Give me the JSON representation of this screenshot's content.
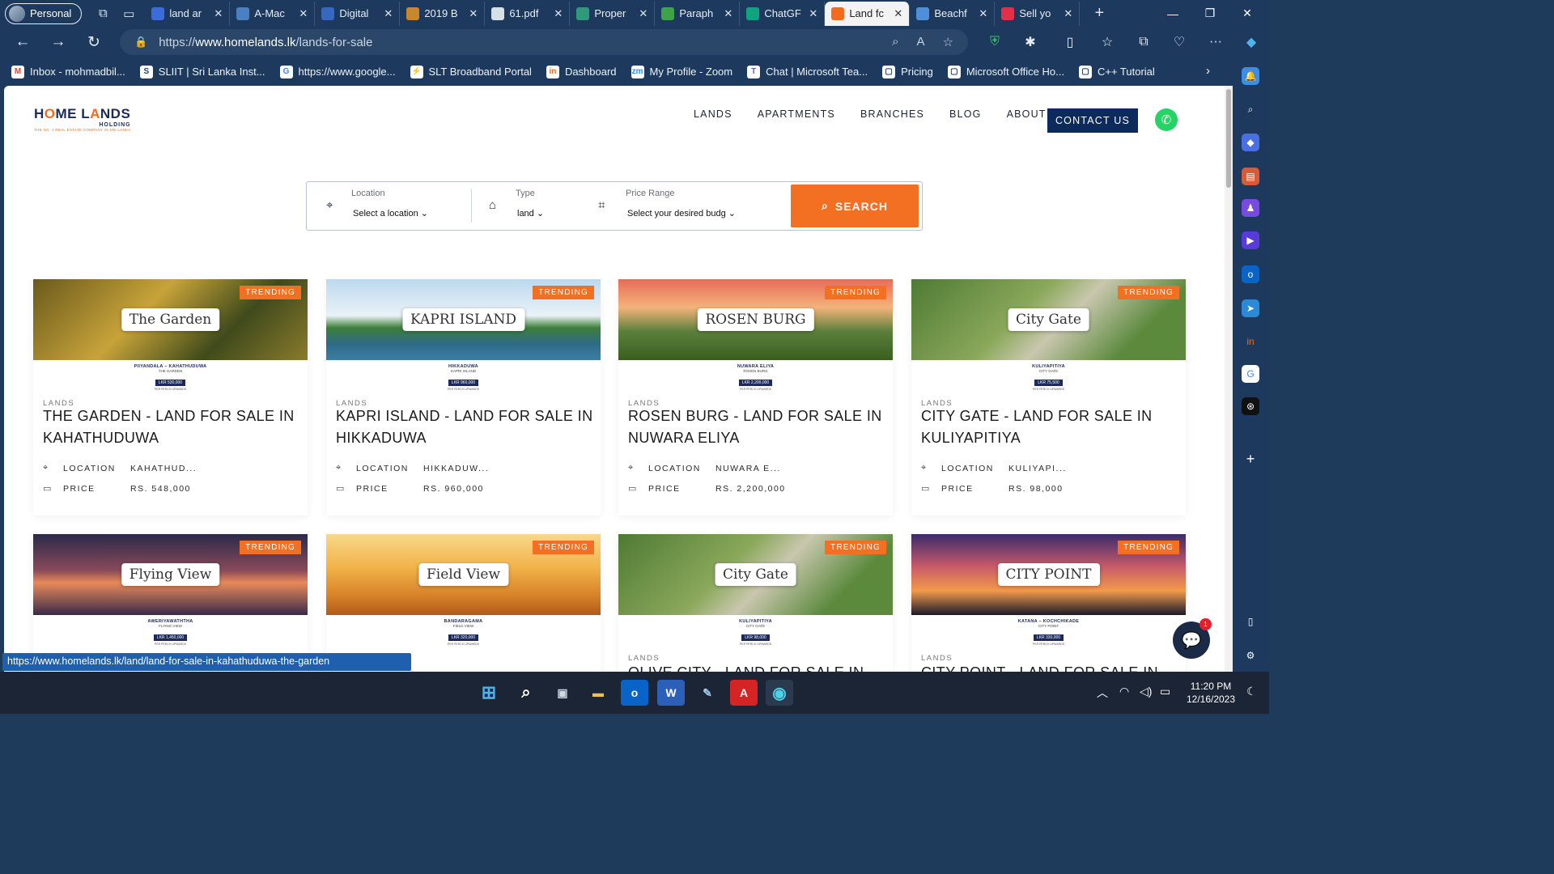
{
  "browser": {
    "profile": "Personal",
    "tabs": [
      {
        "title": "land ar",
        "color": "#3b6dd8"
      },
      {
        "title": "A-Mac",
        "color": "#4a7fc1"
      },
      {
        "title": "Digital",
        "color": "#3768c0"
      },
      {
        "title": "2019 B",
        "color": "#c8872f"
      },
      {
        "title": "61.pdf",
        "color": "#d7dfe8"
      },
      {
        "title": "Proper",
        "color": "#2e9a7a"
      },
      {
        "title": "Paraph",
        "color": "#3da24a"
      },
      {
        "title": "ChatGF",
        "color": "#10a37f"
      },
      {
        "title": "Land fc",
        "color": "#f26b1f",
        "active": true
      },
      {
        "title": "Beachf",
        "color": "#4f8fd8"
      },
      {
        "title": "Sell yo",
        "color": "#e0304a"
      }
    ],
    "url_prefix": "https://",
    "url_domain": "www.homelands.lk",
    "url_path": "/lands-for-sale",
    "favorites": [
      {
        "label": "Inbox - mohmadbil...",
        "icon": "M",
        "color": "#ea4335"
      },
      {
        "label": "SLIIT | Sri Lanka Inst...",
        "icon": "S",
        "color": "#1b3c7a"
      },
      {
        "label": "https://www.google...",
        "icon": "G",
        "color": "#4285f4"
      },
      {
        "label": "SLT Broadband Portal",
        "icon": "⚡",
        "color": "#2d6bd0"
      },
      {
        "label": "Dashboard",
        "icon": "in",
        "color": "#f26b1f"
      },
      {
        "label": "My Profile - Zoom",
        "icon": "zm",
        "color": "#2d8cff"
      },
      {
        "label": "Chat | Microsoft Tea...",
        "icon": "T",
        "color": "#6264a7"
      },
      {
        "label": "Pricing",
        "icon": "▢",
        "color": "#1d3a5e"
      },
      {
        "label": "Microsoft Office Ho...",
        "icon": "▢",
        "color": "#1d3a5e"
      },
      {
        "label": "C++ Tutorial",
        "icon": "▢",
        "color": "#1d3a5e"
      }
    ],
    "status_url": "https://www.homelands.lk/land/land-for-sale-in-kahathuduwa-the-garden"
  },
  "site": {
    "logo_main_a": "H",
    "logo_main_o": "O",
    "logo_main_b": "ME L",
    "logo_main_o2": "A",
    "logo_main_c": "NDS",
    "logo_sub": "HOLDING",
    "logo_tag": "THE NO. 1 REAL ESTATE COMPANY IN SRI LANKA",
    "nav": [
      "LANDS",
      "APARTMENTS",
      "BRANCHES",
      "BLOG",
      "ABOUT US"
    ],
    "contact": "CONTACT US"
  },
  "search": {
    "location_label": "Location",
    "location_value": "Select a location",
    "type_label": "Type",
    "type_value": "land",
    "price_label": "Price Range",
    "price_value": "Select your desired budg",
    "button": "SEARCH"
  },
  "cards": [
    {
      "brand": "The Garden",
      "strip_loc": "PIIYANDALA – KAHATHUDUWA",
      "strip_name": "THE GARDEN",
      "strip_price": "LKR 530,000",
      "strip_sub": "PER PERCH UPWARDS",
      "category": "LANDS",
      "title": "THE GARDEN - LAND FOR SALE IN KAHATHUDUWA",
      "location_label": "LOCATION",
      "location": "KAHATHUD...",
      "price_label": "PRICE",
      "price": "RS. 548,000",
      "trend": "TRENDING",
      "bg": "linear-gradient(135deg,#6a5a1c,#c7a33a 40%,#3f4a1b 70%,#8a7b2c)"
    },
    {
      "brand": "KAPRI ISLAND",
      "strip_loc": "HIKKADUWA",
      "strip_name": "KAPRI ISLAND",
      "strip_price": "LKR 960,000",
      "strip_sub": "PER PERCH UPWARDS",
      "category": "LANDS",
      "title": "KAPRI ISLAND - LAND FOR SALE IN HIKKADUWA",
      "location_label": "LOCATION",
      "location": "HIKKADUW...",
      "price_label": "PRICE",
      "price": "RS. 960,000",
      "trend": "TRENDING",
      "bg": "linear-gradient(180deg,#bcd9ee 0%,#e9f2f7 45%,#3e7f3a 60%,#2e6a86 80%,#3b7ea5 100%)"
    },
    {
      "brand": "ROSEN BURG",
      "strip_loc": "NUWARA ELIYA",
      "strip_name": "ROSEN BURG",
      "strip_price": "LKR 2,200,000",
      "strip_sub": "PER PERCH UPWARDS",
      "category": "LANDS",
      "title": "ROSEN BURG - LAND FOR SALE IN NUWARA ELIYA",
      "location_label": "LOCATION",
      "location": "NUWARA E...",
      "price_label": "PRICE",
      "price": "RS. 2,200,000",
      "trend": "TRENDING",
      "bg": "linear-gradient(180deg,#e86b5a 0%,#f3b37a 35%,#5a7e3a 65%,#3a5e22 100%)"
    },
    {
      "brand": "City Gate",
      "strip_loc": "KULIYAPITIYA",
      "strip_name": "CITY GATE",
      "strip_price": "LKR 75,500",
      "strip_sub": "PER PERCH UPWARDS",
      "category": "LANDS",
      "title": "CITY GATE - LAND FOR SALE IN KULIYAPITIYA",
      "location_label": "LOCATION",
      "location": "KULIYAPI...",
      "price_label": "PRICE",
      "price": "RS. 98,000",
      "trend": "TRENDING",
      "bg": "linear-gradient(135deg,#4f7a35,#8aa85a 40%,#c9c7ae 55%,#5b8a3d 80%)"
    },
    {
      "brand": "Flying View",
      "strip_loc": "AWERIYAWATHTHA",
      "strip_name": "FLYING VIEW",
      "strip_price": "LKR 1,450,000",
      "strip_sub": "PER PERCH UPWARDS",
      "category": "LANDS",
      "title": "",
      "location_label": "",
      "location": "",
      "price_label": "",
      "price": "",
      "trend": "TRENDING",
      "bg": "linear-gradient(180deg,#2a2a4a 0%,#8a4a5a 45%,#e88a5a 60%,#3a2a4a 100%)"
    },
    {
      "brand": "Field View",
      "strip_loc": "BANDARAGAMA",
      "strip_name": "FIELD VIEW",
      "strip_price": "LKR 320,000",
      "strip_sub": "PER PERCH UPWARDS",
      "category": "LANDS",
      "title": "",
      "location_label": "",
      "location": "",
      "price_label": "",
      "price": "",
      "trend": "TRENDING",
      "bg": "linear-gradient(180deg,#f7d88a 0%,#f2b44a 40%,#d8842a 75%,#b25a1a 100%)"
    },
    {
      "brand": "City Gate",
      "strip_loc": "KULIYAPITIYA",
      "strip_name": "CITY GATE",
      "strip_price": "LKR 98,000",
      "strip_sub": "PER PERCH UPWARDS",
      "category": "LANDS",
      "title": "OLIVE CITY - LAND FOR SALE IN",
      "location_label": "",
      "location": "",
      "price_label": "",
      "price": "",
      "trend": "TRENDING",
      "bg": "linear-gradient(135deg,#4f7a35,#8aa85a 40%,#c9c7ae 55%,#5b8a3d 80%)"
    },
    {
      "brand": "CITY POINT",
      "strip_loc": "KATANA – KOCHCHIKADE",
      "strip_name": "CITY POINT",
      "strip_price": "LKR 330,000",
      "strip_sub": "PER PERCH UPWARDS",
      "category": "LANDS",
      "title": "CITY POINT - LAND FOR SALE IN",
      "location_label": "",
      "location": "",
      "price_label": "",
      "price": "",
      "trend": "TRENDING",
      "bg": "linear-gradient(180deg,#3a2a6a 0%,#c85a6a 40%,#f29a4a 70%,#1a1a2a 100%)"
    }
  ],
  "chat": {
    "badge": "1"
  },
  "taskbar": {
    "time": "11:20 PM",
    "date": "12/16/2023"
  }
}
